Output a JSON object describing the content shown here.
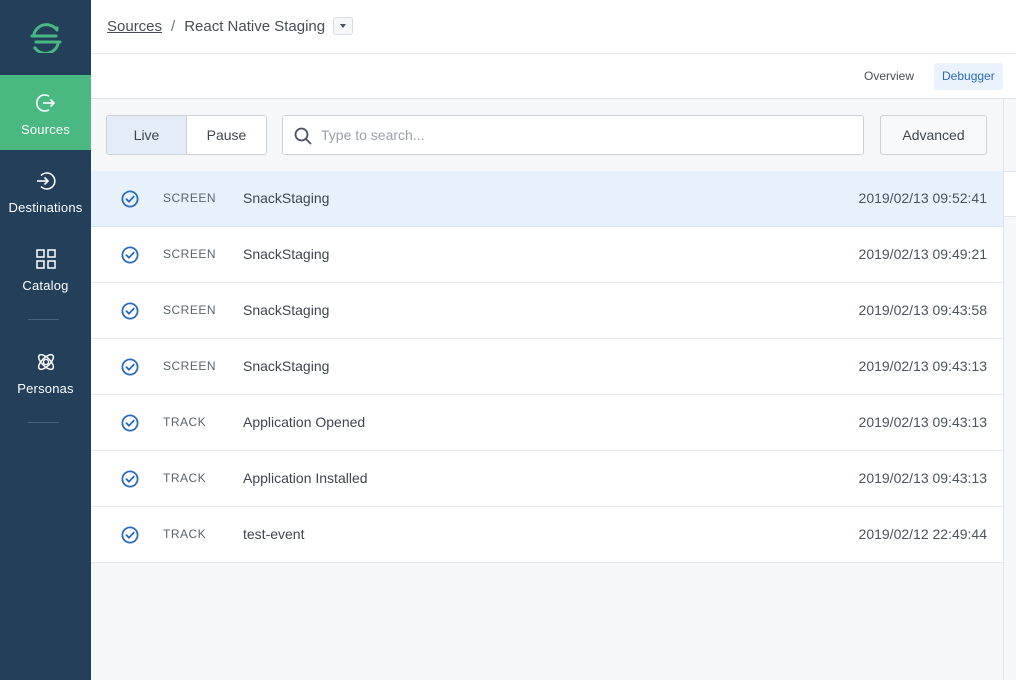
{
  "sidebar": {
    "logo_icon": "segment-logo-icon",
    "items": [
      {
        "label": "Sources",
        "icon": "sources-icon",
        "active": true
      },
      {
        "label": "Destinations",
        "icon": "destinations-icon",
        "active": false
      },
      {
        "label": "Catalog",
        "icon": "catalog-icon",
        "active": false
      },
      {
        "label": "Personas",
        "icon": "personas-icon",
        "active": false
      }
    ]
  },
  "breadcrumb": {
    "root": "Sources",
    "separator": "/",
    "current": "React Native Staging"
  },
  "tabs": [
    {
      "label": "Overview",
      "active": false
    },
    {
      "label": "Debugger",
      "active": true
    }
  ],
  "toolbar": {
    "live_label": "Live",
    "pause_label": "Pause",
    "search_placeholder": "Type to search...",
    "advanced_label": "Advanced"
  },
  "events": [
    {
      "type": "SCREEN",
      "name": "SnackStaging",
      "time": "2019/02/13 09:52:41",
      "selected": true
    },
    {
      "type": "SCREEN",
      "name": "SnackStaging",
      "time": "2019/02/13 09:49:21",
      "selected": false
    },
    {
      "type": "SCREEN",
      "name": "SnackStaging",
      "time": "2019/02/13 09:43:58",
      "selected": false
    },
    {
      "type": "SCREEN",
      "name": "SnackStaging",
      "time": "2019/02/13 09:43:13",
      "selected": false
    },
    {
      "type": "TRACK",
      "name": "Application Opened",
      "time": "2019/02/13 09:43:13",
      "selected": false
    },
    {
      "type": "TRACK",
      "name": "Application Installed",
      "time": "2019/02/13 09:43:13",
      "selected": false
    },
    {
      "type": "TRACK",
      "name": "test-event",
      "time": "2019/02/12 22:49:44",
      "selected": false
    }
  ],
  "colors": {
    "sidebar_bg": "#233f5a",
    "sidebar_active": "#49b881",
    "accent_blue": "#2a6bbf",
    "selected_row": "#e6f1fb"
  }
}
